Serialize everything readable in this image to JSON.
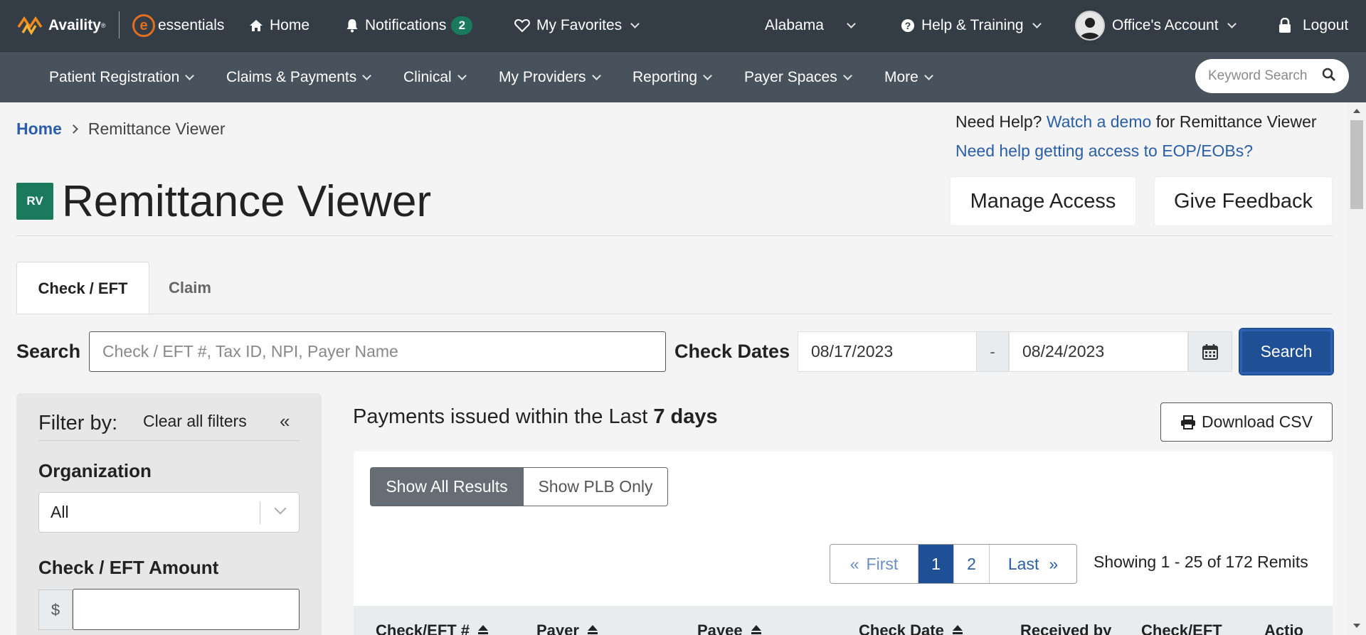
{
  "topbar": {
    "brand": "Availity",
    "brand_mark": "®",
    "essentials": "essentials",
    "home": "Home",
    "notifications": "Notifications",
    "notifications_count": "2",
    "favorites": "My Favorites",
    "state": "Alabama",
    "help": "Help & Training",
    "account": "Office's Account",
    "logout": "Logout"
  },
  "nav": {
    "items": [
      "Patient Registration",
      "Claims & Payments",
      "Clinical",
      "My Providers",
      "Reporting",
      "Payer Spaces",
      "More"
    ],
    "search_placeholder": "Keyword Search"
  },
  "breadcrumb": {
    "home": "Home",
    "current": "Remittance Viewer"
  },
  "help": {
    "prefix": "Need Help?",
    "demo_link": "Watch a demo",
    "suffix": "for Remittance Viewer",
    "access_link": "Need help getting access to EOP/EOBs?"
  },
  "header": {
    "badge": "RV",
    "title": "Remittance Viewer",
    "manage_access": "Manage Access",
    "give_feedback": "Give Feedback"
  },
  "tabs": [
    {
      "label": "Check / EFT",
      "active": true
    },
    {
      "label": "Claim",
      "active": false
    }
  ],
  "search": {
    "label": "Search",
    "placeholder": "Check / EFT #, Tax ID, NPI, Payer Name",
    "dates_label": "Check Dates",
    "date_from": "08/17/2023",
    "date_sep": "-",
    "date_to": "08/24/2023",
    "button": "Search"
  },
  "filter": {
    "title": "Filter by:",
    "clear": "Clear all filters",
    "collapse": "«",
    "organization_label": "Organization",
    "organization_value": "All",
    "amount_label": "Check / EFT Amount",
    "currency": "$"
  },
  "results": {
    "title_prefix": "Payments issued within the Last",
    "title_bold": "7 days",
    "download": "Download CSV",
    "show_all": "Show All Results",
    "show_plb": "Show PLB Only",
    "pager": {
      "first": "First",
      "current": "1",
      "page2": "2",
      "last": "Last"
    },
    "showing": "Showing 1 - 25 of 172 Remits",
    "columns": [
      "Check/EFT #",
      "Payer",
      "Payee",
      "Check Date",
      "Received by",
      "Check/EFT",
      "Actio"
    ]
  },
  "colors": {
    "topbar": "#343c45",
    "navbar": "#48525d",
    "accent": "#1f4f95",
    "brand_green": "#1a7a5b",
    "link": "#2a5ea7"
  }
}
